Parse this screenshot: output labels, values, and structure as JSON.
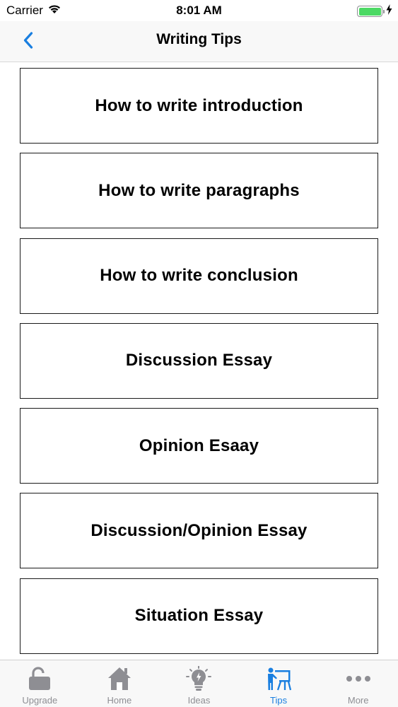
{
  "status_bar": {
    "carrier": "Carrier",
    "time": "8:01 AM"
  },
  "nav": {
    "title": "Writing Tips",
    "back_icon": "chevron-left-icon"
  },
  "tips": [
    {
      "label": "How to write introduction"
    },
    {
      "label": "How to write paragraphs"
    },
    {
      "label": "How to write conclusion"
    },
    {
      "label": "Discussion Essay"
    },
    {
      "label": "Opinion Esaay"
    },
    {
      "label": "Discussion/Opinion Essay"
    },
    {
      "label": "Situation Essay"
    }
  ],
  "tab_bar": {
    "tabs": [
      {
        "label": "Upgrade",
        "icon": "unlock-icon"
      },
      {
        "label": "Home",
        "icon": "home-icon"
      },
      {
        "label": "Ideas",
        "icon": "lightbulb-icon"
      },
      {
        "label": "Tips",
        "icon": "teacher-icon",
        "active": true
      },
      {
        "label": "More",
        "icon": "more-icon"
      }
    ]
  },
  "colors": {
    "accent": "#1a7fe0",
    "inactive": "#8e8e93",
    "battery": "#4cd964"
  }
}
